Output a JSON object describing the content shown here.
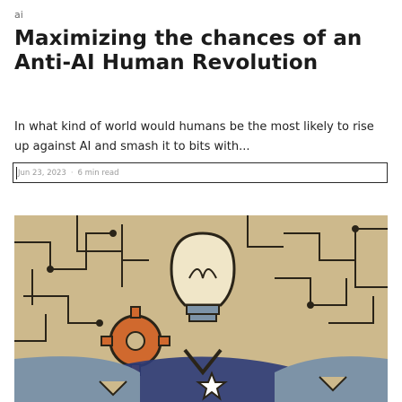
{
  "post": {
    "tag": "ai",
    "title": "Maximizing the chances of an Anti-AI Human Revolution",
    "excerpt": "In what kind of world would humans be the most likely to rise up against AI and smash it to bits with...",
    "date": "Jun 23, 2023",
    "separator": "·",
    "read_time": "6 min read"
  },
  "image": {
    "icons": [
      "gear-icon",
      "lightbulb-icon",
      "star-icon",
      "circuit-pattern"
    ],
    "colors": {
      "sand": "#cdb98c",
      "ink": "#2a2418",
      "blue_grey": "#7d93a7",
      "orange": "#d0692e",
      "navy": "#2d3c78"
    }
  }
}
